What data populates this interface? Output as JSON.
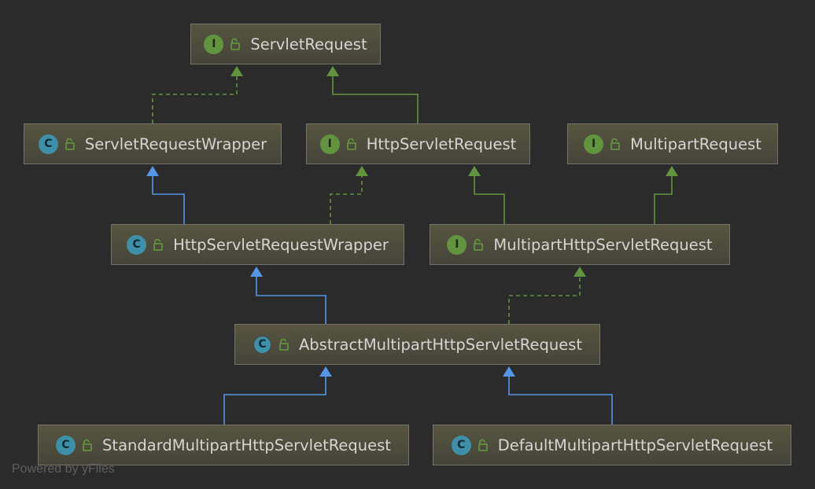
{
  "diagram": {
    "nodes": [
      {
        "id": "servlet-request",
        "label": "ServletRequest",
        "kind": "interface",
        "kind_letter": "I"
      },
      {
        "id": "servlet-request-wrapper",
        "label": "ServletRequestWrapper",
        "kind": "class",
        "kind_letter": "C"
      },
      {
        "id": "http-servlet-request",
        "label": "HttpServletRequest",
        "kind": "interface",
        "kind_letter": "I"
      },
      {
        "id": "multipart-request",
        "label": "MultipartRequest",
        "kind": "interface",
        "kind_letter": "I"
      },
      {
        "id": "http-servlet-request-wrapper",
        "label": "HttpServletRequestWrapper",
        "kind": "class",
        "kind_letter": "C"
      },
      {
        "id": "multipart-http-servlet-request",
        "label": "MultipartHttpServletRequest",
        "kind": "interface",
        "kind_letter": "I"
      },
      {
        "id": "abstract-multipart-http-servlet-request",
        "label": "AbstractMultipartHttpServletRequest",
        "kind": "abstract",
        "kind_letter": "C"
      },
      {
        "id": "standard-multipart-http-servlet-request",
        "label": "StandardMultipartHttpServletRequest",
        "kind": "class",
        "kind_letter": "C"
      },
      {
        "id": "default-multipart-http-servlet-request",
        "label": "DefaultMultipartHttpServletRequest",
        "kind": "class",
        "kind_letter": "C"
      }
    ],
    "edges": [
      {
        "from": "servlet-request-wrapper",
        "to": "servlet-request",
        "type": "implements"
      },
      {
        "from": "http-servlet-request",
        "to": "servlet-request",
        "type": "extends-interface"
      },
      {
        "from": "http-servlet-request-wrapper",
        "to": "servlet-request-wrapper",
        "type": "extends-class"
      },
      {
        "from": "http-servlet-request-wrapper",
        "to": "http-servlet-request",
        "type": "implements"
      },
      {
        "from": "multipart-http-servlet-request",
        "to": "http-servlet-request",
        "type": "extends-interface"
      },
      {
        "from": "multipart-http-servlet-request",
        "to": "multipart-request",
        "type": "extends-interface"
      },
      {
        "from": "abstract-multipart-http-servlet-request",
        "to": "http-servlet-request-wrapper",
        "type": "extends-class"
      },
      {
        "from": "abstract-multipart-http-servlet-request",
        "to": "multipart-http-servlet-request",
        "type": "implements"
      },
      {
        "from": "standard-multipart-http-servlet-request",
        "to": "abstract-multipart-http-servlet-request",
        "type": "extends-class"
      },
      {
        "from": "default-multipart-http-servlet-request",
        "to": "abstract-multipart-http-servlet-request",
        "type": "extends-class"
      }
    ],
    "colors": {
      "background": "#2b2b2b",
      "interface_edge": "#62933f",
      "class_edge": "#5596e6",
      "interface_icon": "#62933f",
      "class_icon": "#3e8fa8",
      "lock_icon": "#62933f"
    }
  },
  "footer": {
    "text": "Powered by yFiles"
  }
}
